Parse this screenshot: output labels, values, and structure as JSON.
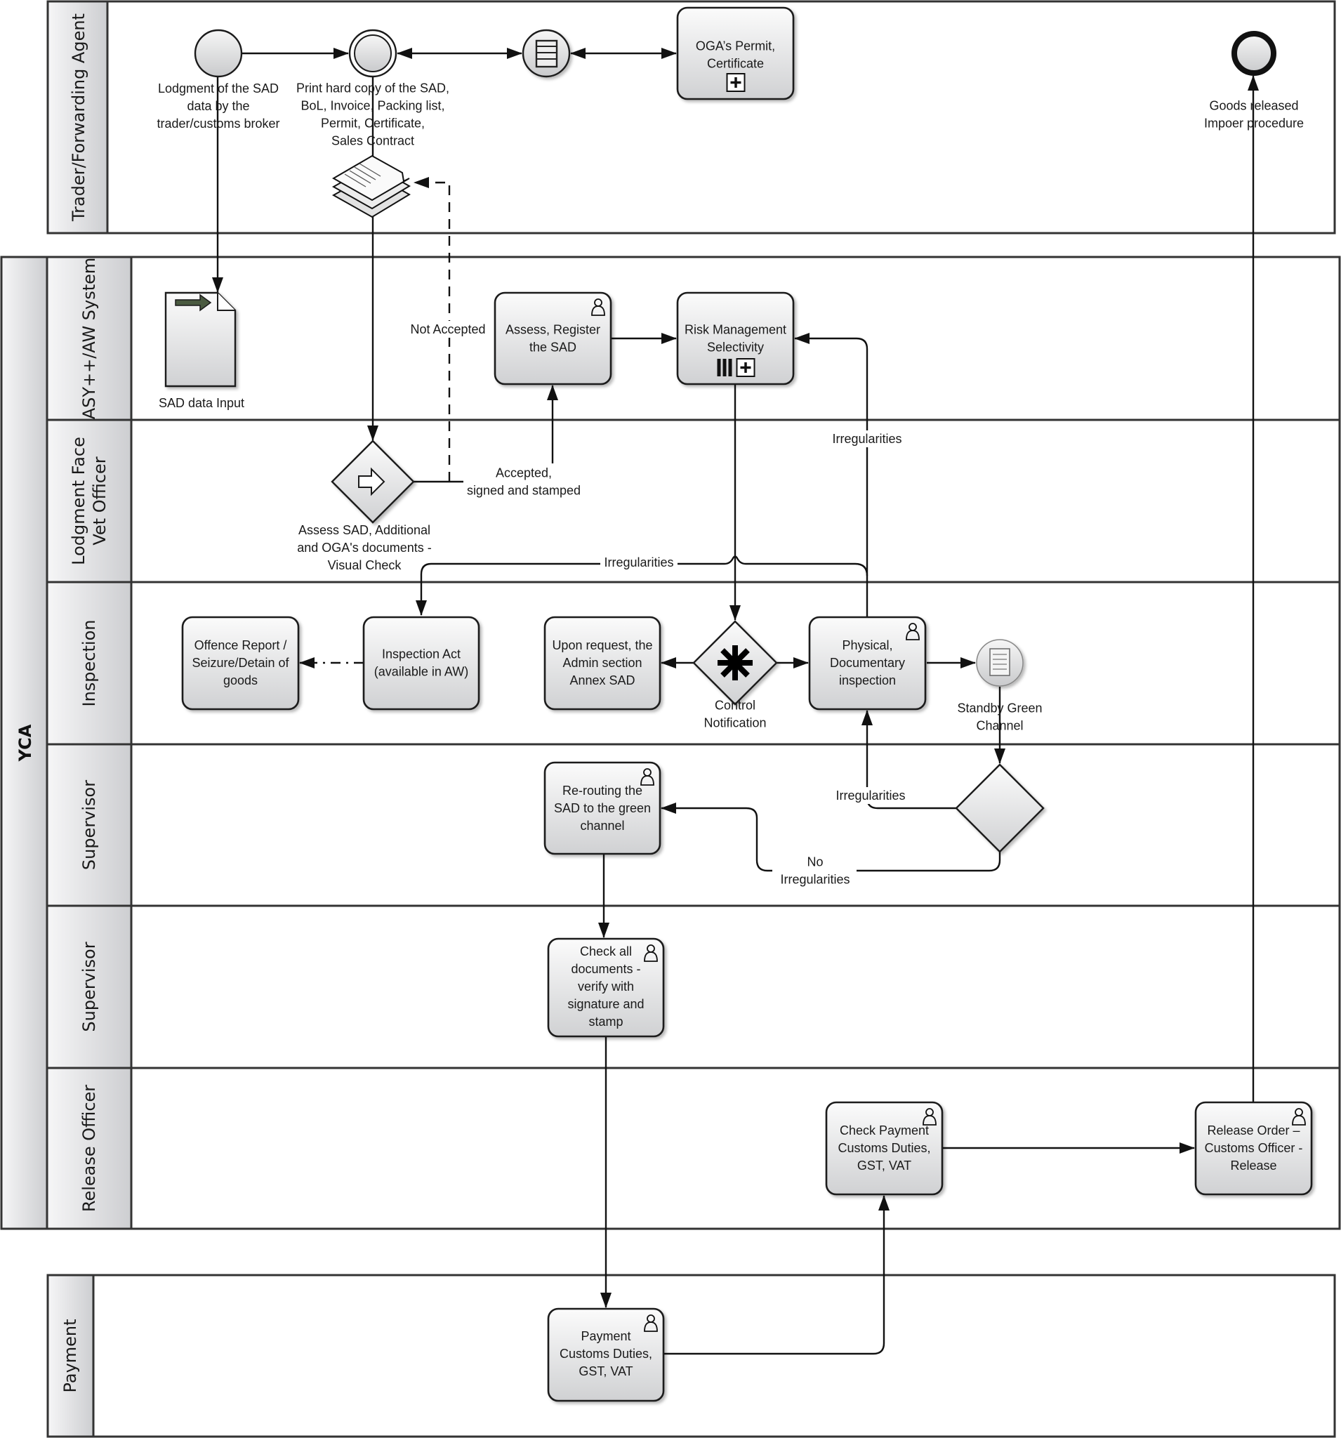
{
  "pools": {
    "trader": {
      "label": "Trader/Forwarding Agent"
    },
    "yca": {
      "label": "YCA"
    },
    "payment": {
      "label": "Payment"
    }
  },
  "lanes": [
    {
      "id": "asy",
      "label_lines": [
        "ASY++/AW System"
      ]
    },
    {
      "id": "lodgment",
      "label_lines": [
        "Lodgment Face",
        "Vet Officer"
      ]
    },
    {
      "id": "inspection",
      "label_lines": [
        "Inspection"
      ]
    },
    {
      "id": "supervisor1",
      "label_lines": [
        "Supervisor"
      ]
    },
    {
      "id": "supervisor2",
      "label_lines": [
        "Supervisor"
      ]
    },
    {
      "id": "release",
      "label_lines": [
        "Release Officer"
      ]
    }
  ],
  "events": {
    "start": {
      "type": "start",
      "label_lines": [
        "Lodgment of the SAD",
        "data by the",
        "trader/customs broker"
      ]
    },
    "print": {
      "type": "intermediate",
      "label_lines": [
        "Print hard copy of the SAD,",
        "BoL, Invoice, Packing list,",
        "Permit, Certificate,",
        "Sales Contract"
      ]
    },
    "message": {
      "type": "intermediate-message",
      "icon": "document-list-icon"
    },
    "end": {
      "type": "end",
      "label_lines": [
        "Goods released",
        "Impoer procedure"
      ]
    },
    "standby": {
      "type": "intermediate-document",
      "label_lines": [
        "Standby Green",
        "Channel"
      ]
    }
  },
  "tasks": {
    "oga": {
      "label_lines": [
        "OGA’s Permit,",
        "Certificate"
      ],
      "marker": "subprocess"
    },
    "assess_register": {
      "label_lines": [
        "Assess, Register",
        "the SAD"
      ],
      "marker": "user"
    },
    "risk": {
      "label_lines": [
        "Risk Management",
        "Selectivity"
      ],
      "marker": "parallel-subprocess"
    },
    "offence": {
      "label_lines": [
        "Offence Report /",
        "Seizure/Detain of",
        "goods"
      ]
    },
    "inspection_act": {
      "label_lines": [
        "Inspection Act",
        "(available in AW)"
      ]
    },
    "admin_annex": {
      "label_lines": [
        "Upon request, the",
        "Admin section",
        "Annex SAD"
      ]
    },
    "physical": {
      "label_lines": [
        "Physical,",
        "Documentary",
        "inspection"
      ],
      "marker": "user"
    },
    "rerouting": {
      "label_lines": [
        "Re-routing the",
        "SAD to the green",
        "channel"
      ],
      "marker": "user"
    },
    "check_docs": {
      "label_lines": [
        "Check all",
        "documents -",
        "verify with",
        "signature and",
        "stamp"
      ],
      "marker": "user"
    },
    "check_payment": {
      "label_lines": [
        "Check Payment",
        "Customs Duties,",
        "GST, VAT"
      ],
      "marker": "user"
    },
    "release_order": {
      "label_lines": [
        "Release Order –",
        "Customs Officer -",
        "Release"
      ],
      "marker": "user"
    },
    "payment": {
      "label_lines": [
        "Payment",
        "Customs Duties,",
        "GST, VAT"
      ],
      "marker": "user"
    }
  },
  "data_objects": {
    "sad_input": {
      "label": "SAD data Input"
    },
    "doc_stack": {
      "label": ""
    }
  },
  "gateways": {
    "visual_check": {
      "type": "event-based-arrow",
      "label_lines": [
        "Assess SAD, Additional",
        "and OGA's documents -",
        "Visual Check"
      ]
    },
    "control": {
      "type": "complex",
      "label_lines": [
        "Control",
        "Notification"
      ]
    },
    "supervisor": {
      "type": "exclusive",
      "label_lines": []
    }
  },
  "flow_labels": {
    "not_accepted": "Not Accepted",
    "accepted_lines": [
      "Accepted,",
      "signed and stamped"
    ],
    "irregularities_risk": "Irregularities",
    "irregularities_inspection": "Irregularities",
    "irregularities_supervisor": "Irregularities",
    "no_irregularities_lines": [
      "No",
      "Irregularities"
    ]
  },
  "colors": {
    "stroke": "#1a1a1a",
    "header_light": "#f4f4f5",
    "header_dark": "#cfd0d3",
    "task_top": "#fafafa",
    "task_bottom": "#d2d3d5",
    "data_arrow": "#4a5a40"
  }
}
